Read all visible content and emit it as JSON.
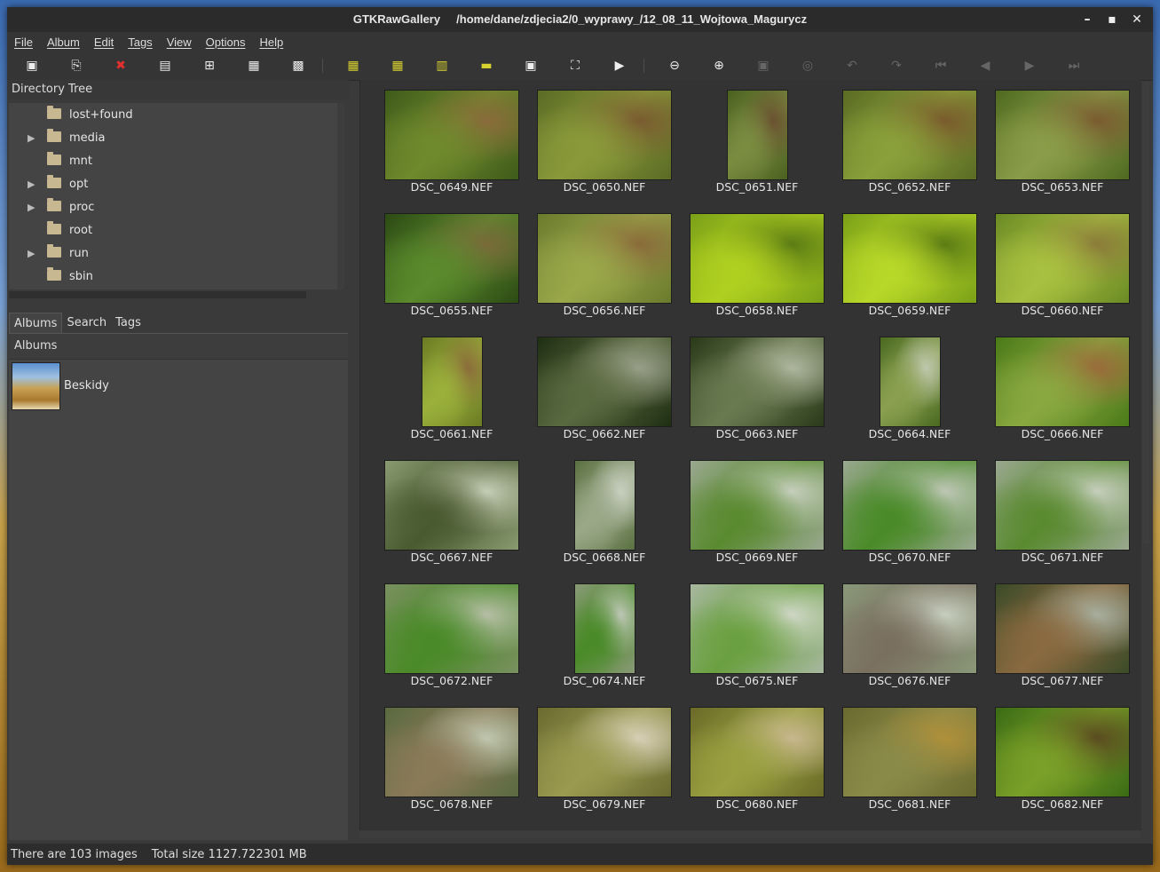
{
  "window": {
    "title": "GTKRawGallery     /home/dane/zdjecia2/0_wyprawy_/12_08_11_Wojtowa_Magurycz",
    "controls": [
      "minimize-icon",
      "maximize-icon",
      "close-icon"
    ]
  },
  "menu": [
    "File",
    "Album",
    "Edit",
    "Tags",
    "View",
    "Options",
    "Help"
  ],
  "toolbar": {
    "icons": [
      {
        "name": "open-folder-icon",
        "glyph": "▣"
      },
      {
        "name": "export-icon",
        "glyph": "⎘"
      },
      {
        "name": "delete-icon",
        "glyph": "✖",
        "color": "#e03030"
      },
      {
        "name": "list-view-icon",
        "glyph": "▤"
      },
      {
        "name": "grid-large-icon",
        "glyph": "⊞"
      },
      {
        "name": "grid-medium-icon",
        "glyph": "▦"
      },
      {
        "name": "grid-small-icon",
        "glyph": "▩"
      },
      {
        "name": "thumbnails-icon",
        "glyph": "▦",
        "color": "#d8d230"
      },
      {
        "name": "thumbnails-list-icon",
        "glyph": "▦",
        "color": "#d8d230"
      },
      {
        "name": "filmstrip-icon",
        "glyph": "▥",
        "color": "#d8d230"
      },
      {
        "name": "single-view-icon",
        "glyph": "▬",
        "color": "#d8d230"
      },
      {
        "name": "compare-icon",
        "glyph": "▣"
      },
      {
        "name": "fullscreen-icon",
        "glyph": "⛶"
      },
      {
        "name": "slideshow-play-icon",
        "glyph": "▶"
      },
      {
        "name": "zoom-out-icon",
        "glyph": "⊖"
      },
      {
        "name": "zoom-in-icon",
        "glyph": "⊕"
      },
      {
        "name": "zoom-fit-icon",
        "glyph": "▣",
        "dim": true
      },
      {
        "name": "zoom-100-icon",
        "glyph": "◎",
        "dim": true
      },
      {
        "name": "rotate-left-icon",
        "glyph": "↶",
        "dim": true
      },
      {
        "name": "rotate-right-icon",
        "glyph": "↷",
        "dim": true
      },
      {
        "name": "first-image-icon",
        "glyph": "⏮",
        "dim": true
      },
      {
        "name": "previous-image-icon",
        "glyph": "◀",
        "dim": true
      },
      {
        "name": "next-image-icon",
        "glyph": "▶",
        "dim": true
      },
      {
        "name": "last-image-icon",
        "glyph": "⏭",
        "dim": true
      }
    ]
  },
  "directory_tree": {
    "header": "Directory Tree",
    "items": [
      {
        "label": "lost+found",
        "expandable": false
      },
      {
        "label": "media",
        "expandable": true
      },
      {
        "label": "mnt",
        "expandable": false
      },
      {
        "label": "opt",
        "expandable": true
      },
      {
        "label": "proc",
        "expandable": true
      },
      {
        "label": "root",
        "expandable": false
      },
      {
        "label": "run",
        "expandable": true
      },
      {
        "label": "sbin",
        "expandable": false
      }
    ]
  },
  "tabs": [
    "Albums",
    "Search",
    "Tags"
  ],
  "albums": {
    "header": "Albums",
    "items": [
      {
        "name": "Beskidy"
      }
    ]
  },
  "images": [
    {
      "name": "DSC_0649.NEF",
      "portrait": false,
      "colors": [
        "#3e5a1a",
        "#6f8a2c",
        "#8a6a3a"
      ]
    },
    {
      "name": "DSC_0650.NEF",
      "portrait": false,
      "colors": [
        "#5a6a24",
        "#8a9a3a",
        "#7a5a30"
      ]
    },
    {
      "name": "DSC_0651.NEF",
      "portrait": true,
      "colors": [
        "#4a6020",
        "#7a8c40",
        "#6a5030"
      ]
    },
    {
      "name": "DSC_0652.NEF",
      "portrait": false,
      "colors": [
        "#5a6a24",
        "#8aa03a",
        "#7a5a2c"
      ]
    },
    {
      "name": "DSC_0653.NEF",
      "portrait": false,
      "colors": [
        "#4e6a20",
        "#8a9c48",
        "#7a5a30"
      ]
    },
    {
      "name": "DSC_0655.NEF",
      "portrait": false,
      "colors": [
        "#2c4a14",
        "#5a8a2c",
        "#7a6a3a"
      ]
    },
    {
      "name": "DSC_0656.NEF",
      "portrait": false,
      "colors": [
        "#6a7a2c",
        "#9aa84a",
        "#8a6a3a"
      ]
    },
    {
      "name": "DSC_0658.NEF",
      "portrait": false,
      "colors": [
        "#7aa018",
        "#b0d020",
        "#5a7a14"
      ]
    },
    {
      "name": "DSC_0659.NEF",
      "portrait": false,
      "colors": [
        "#7aa018",
        "#b8d828",
        "#5a7a14"
      ]
    },
    {
      "name": "DSC_0660.NEF",
      "portrait": false,
      "colors": [
        "#6a8a24",
        "#a8c040",
        "#8a7a3a"
      ]
    },
    {
      "name": "DSC_0661.NEF",
      "portrait": true,
      "colors": [
        "#6a7a24",
        "#9ab03a",
        "#8a6a3a"
      ]
    },
    {
      "name": "DSC_0662.NEF",
      "portrait": false,
      "colors": [
        "#1e2e12",
        "#5a6a40",
        "#9aa08a"
      ]
    },
    {
      "name": "DSC_0663.NEF",
      "portrait": false,
      "colors": [
        "#2a3a1a",
        "#6a7a50",
        "#b0b8a0"
      ]
    },
    {
      "name": "DSC_0664.NEF",
      "portrait": true,
      "colors": [
        "#4a6a20",
        "#8aa050",
        "#c0c8b0"
      ]
    },
    {
      "name": "DSC_0666.NEF",
      "portrait": false,
      "colors": [
        "#4a7a18",
        "#8aa840",
        "#9a6a3a"
      ]
    },
    {
      "name": "DSC_0667.NEF",
      "portrait": false,
      "colors": [
        "#8a9a70",
        "#4a5a30",
        "#c8d0b8"
      ]
    },
    {
      "name": "DSC_0668.NEF",
      "portrait": true,
      "colors": [
        "#5a7040",
        "#9aa888",
        "#c8d0c0"
      ]
    },
    {
      "name": "DSC_0669.NEF",
      "portrait": false,
      "colors": [
        "#9aa890",
        "#5a8a30",
        "#c8d0c0"
      ]
    },
    {
      "name": "DSC_0670.NEF",
      "portrait": false,
      "colors": [
        "#9aa890",
        "#4a8a28",
        "#c0c8b8"
      ]
    },
    {
      "name": "DSC_0671.NEF",
      "portrait": false,
      "colors": [
        "#9aa890",
        "#5a8a30",
        "#c8d0c0"
      ]
    },
    {
      "name": "DSC_0672.NEF",
      "portrait": false,
      "colors": [
        "#7a9060",
        "#4a8a28",
        "#b8c0a8"
      ]
    },
    {
      "name": "DSC_0674.NEF",
      "portrait": true,
      "colors": [
        "#8a9a78",
        "#4a8a28",
        "#c0c8b8"
      ]
    },
    {
      "name": "DSC_0675.NEF",
      "portrait": false,
      "colors": [
        "#a8b8a0",
        "#6aa040",
        "#d0d8c8"
      ]
    },
    {
      "name": "DSC_0676.NEF",
      "portrait": false,
      "colors": [
        "#8a9878",
        "#7a7060",
        "#c8d0c0"
      ]
    },
    {
      "name": "DSC_0677.NEF",
      "portrait": false,
      "colors": [
        "#3a4a28",
        "#8a6a40",
        "#a8b0a0"
      ]
    },
    {
      "name": "DSC_0678.NEF",
      "portrait": false,
      "colors": [
        "#5a6a40",
        "#8a7a58",
        "#c0c8b0"
      ]
    },
    {
      "name": "DSC_0679.NEF",
      "portrait": false,
      "colors": [
        "#6a6a30",
        "#9a9a50",
        "#d8d0b8"
      ]
    },
    {
      "name": "DSC_0680.NEF",
      "portrait": false,
      "colors": [
        "#6a6a28",
        "#9aa040",
        "#c8b890"
      ]
    },
    {
      "name": "DSC_0681.NEF",
      "portrait": false,
      "colors": [
        "#6a6a30",
        "#8a8a48",
        "#b0903a"
      ]
    },
    {
      "name": "DSC_0682.NEF",
      "portrait": false,
      "colors": [
        "#3a6a14",
        "#7aa028",
        "#5a4a20"
      ]
    }
  ],
  "status": {
    "count": "There are 103 images",
    "size": "Total size 1127.722301 MB"
  }
}
